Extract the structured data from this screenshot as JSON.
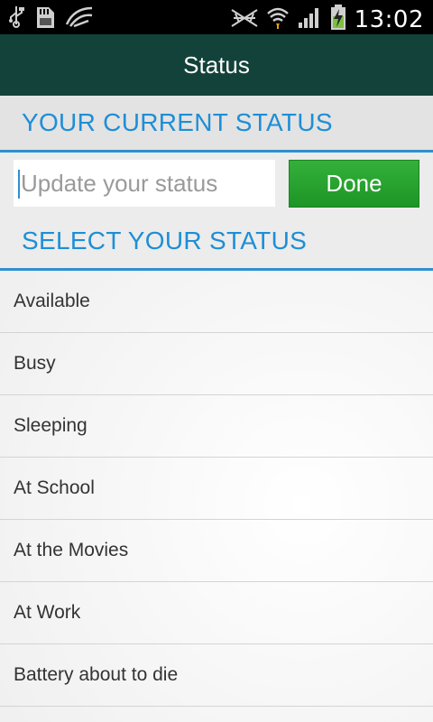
{
  "status_bar": {
    "time": "13:02",
    "left_icons": [
      "usb-icon",
      "sd-card-icon",
      "sync-icon"
    ],
    "right_icons": [
      "no-signal-icon",
      "wifi-icon",
      "cell-signal-icon",
      "battery-charging-icon"
    ]
  },
  "action_bar": {
    "title": "Status"
  },
  "current_status": {
    "header": "YOUR CURRENT STATUS",
    "placeholder": "Update your status",
    "value": "",
    "done_label": "Done"
  },
  "select_status": {
    "header": "SELECT YOUR STATUS",
    "items": [
      {
        "label": "Available"
      },
      {
        "label": "Busy"
      },
      {
        "label": "Sleeping"
      },
      {
        "label": "At School"
      },
      {
        "label": "At the Movies"
      },
      {
        "label": "At Work"
      },
      {
        "label": "Battery about to die"
      }
    ]
  },
  "colors": {
    "action_bar_bg": "#13423a",
    "accent_blue": "#1e8ed6",
    "done_green": "#2aa532"
  }
}
